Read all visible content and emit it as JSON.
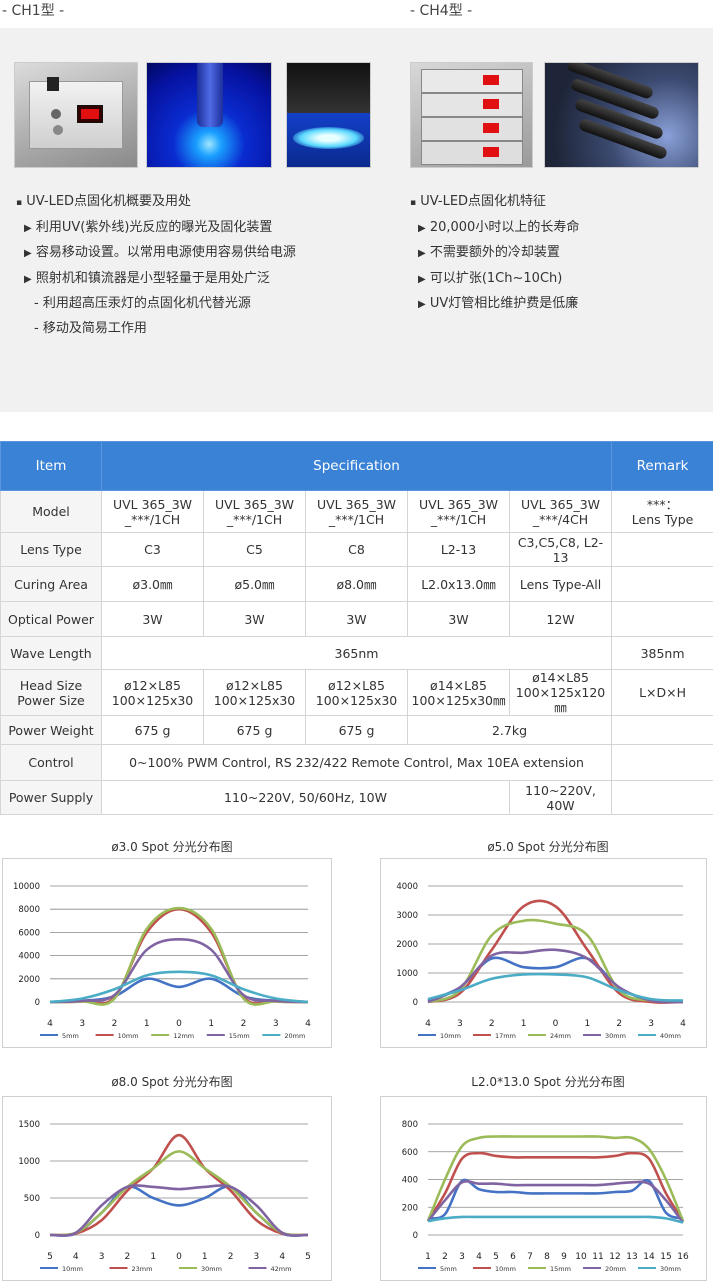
{
  "headers": {
    "ch1": "- CH1型 -",
    "ch4": "- CH4型 -"
  },
  "left_list": {
    "title": "UV-LED点固化机概要及用处",
    "items": [
      "利用UV(紫外线)光反应的曝光及固化装置",
      "容易移动设置。以常用电源使用容易供给电源",
      "照射机和镇流器是小型轻量于是用处广泛"
    ],
    "subitems": [
      "- 利用超高压汞灯的点固化机代替光源",
      "- 移动及简易工作用"
    ]
  },
  "right_list": {
    "title": "UV-LED点固化机特征",
    "items": [
      "20,000小时以上的长寿命",
      "不需要额外的冷却装置",
      "可以扩张(1Ch~10Ch)",
      "UV灯管相比维护费是低廉"
    ]
  },
  "table": {
    "head": {
      "item": "Item",
      "spec": "Specification",
      "remark": "Remark"
    },
    "model": {
      "label": "Model",
      "cells": [
        [
          "UVL 365_3W",
          "_***/1CH"
        ],
        [
          "UVL 365_3W",
          "_***/1CH"
        ],
        [
          "UVL 365_3W",
          "_***/1CH"
        ],
        [
          "UVL 365_3W",
          "_***/1CH"
        ],
        [
          "UVL 365_3W",
          "_***/4CH"
        ]
      ],
      "remark": [
        "***：",
        "Lens Type"
      ]
    },
    "lens": {
      "label": "Lens Type",
      "cells": [
        "C3",
        "C5",
        "C8",
        "L2-13",
        "C3,C5,C8, L2-13"
      ]
    },
    "area": {
      "label": "Curing Area",
      "cells": [
        "ø3.0㎜",
        "ø5.0㎜",
        "ø8.0㎜",
        "L2.0x13.0㎜",
        "Lens Type-All"
      ]
    },
    "power": {
      "label": "Optical Power",
      "cells": [
        "3W",
        "3W",
        "3W",
        "3W",
        "12W"
      ]
    },
    "wave": {
      "label": "Wave Length",
      "value": "365nm",
      "remark": "385nm"
    },
    "head_size": {
      "label": [
        "Head Size",
        "Power Size"
      ],
      "cells": [
        [
          "ø12×L85",
          "100×125x30"
        ],
        [
          "ø12×L85",
          "100×125x30"
        ],
        [
          "ø12×L85",
          "100×125x30"
        ],
        [
          "ø14×L85",
          "100×125x30㎜"
        ],
        [
          "ø14×L85",
          "100×125x120㎜"
        ]
      ],
      "remark": "L×D×H"
    },
    "weight": {
      "label": "Power Weight",
      "cells": [
        "675 g",
        "675 g",
        "675 g"
      ],
      "merged": "2.7kg"
    },
    "control": {
      "label": "Control",
      "value": "0~100% PWM Control, RS 232/422 Remote Control, Max 10EA extension"
    },
    "supply": {
      "label": "Power Supply",
      "value": "110~220V, 50/60Hz, 10W",
      "value_4ch": "110~220V, 40W"
    }
  },
  "colors": {
    "blue": "#4472c4",
    "red": "#c0504d",
    "green": "#9bbb59",
    "purple": "#8064a2",
    "cyan": "#4bacc6",
    "header": "#3a82d6"
  },
  "chart_data": [
    {
      "type": "line",
      "title": "ø3.0 Spot 分光分布图",
      "x": [
        4,
        3,
        2,
        1,
        0,
        1,
        2,
        3,
        4
      ],
      "ylim": [
        0,
        10000
      ],
      "yticks": [
        0,
        2000,
        4000,
        6000,
        8000,
        10000
      ],
      "grid": true,
      "legend": "bottom",
      "series": [
        {
          "name": "5mm",
          "color": "#4472c4",
          "values": [
            0,
            100,
            500,
            2000,
            1300,
            2000,
            500,
            100,
            0
          ]
        },
        {
          "name": "10mm",
          "color": "#c0504d",
          "values": [
            0,
            50,
            400,
            6000,
            8000,
            6000,
            400,
            50,
            0
          ]
        },
        {
          "name": "12mm",
          "color": "#9bbb59",
          "values": [
            0,
            50,
            300,
            6300,
            8100,
            6300,
            300,
            50,
            0
          ]
        },
        {
          "name": "15mm",
          "color": "#8064a2",
          "values": [
            0,
            100,
            600,
            4500,
            5400,
            4500,
            600,
            100,
            0
          ]
        },
        {
          "name": "20mm",
          "color": "#4bacc6",
          "values": [
            0,
            300,
            1100,
            2300,
            2600,
            2300,
            1100,
            300,
            0
          ]
        }
      ]
    },
    {
      "type": "line",
      "title": "ø5.0 Spot 分光分布图",
      "x": [
        4,
        3,
        2,
        1,
        0,
        1,
        2,
        3,
        4
      ],
      "ylim": [
        0,
        4000
      ],
      "yticks": [
        0,
        1000,
        2000,
        3000,
        4000
      ],
      "grid": true,
      "legend": "bottom",
      "series": [
        {
          "name": "10mm",
          "color": "#4472c4",
          "values": [
            50,
            500,
            1500,
            1200,
            1200,
            1500,
            500,
            50,
            0
          ]
        },
        {
          "name": "17mm",
          "color": "#c0504d",
          "values": [
            0,
            300,
            1800,
            3300,
            3300,
            1800,
            300,
            0,
            0
          ]
        },
        {
          "name": "24mm",
          "color": "#9bbb59",
          "values": [
            0,
            400,
            2300,
            2800,
            2700,
            2300,
            400,
            50,
            0
          ]
        },
        {
          "name": "30mm",
          "color": "#8064a2",
          "values": [
            0,
            500,
            1600,
            1700,
            1800,
            1500,
            500,
            50,
            0
          ]
        },
        {
          "name": "40mm",
          "color": "#4bacc6",
          "values": [
            100,
            400,
            800,
            950,
            950,
            850,
            400,
            100,
            50
          ]
        }
      ]
    },
    {
      "type": "line",
      "title": "ø8.0 Spot 分光分布图",
      "x": [
        5,
        4,
        3,
        2,
        1,
        0,
        1,
        2,
        3,
        4,
        5
      ],
      "ylim": [
        0,
        1500
      ],
      "yticks": [
        0,
        500,
        1000,
        1500
      ],
      "grid": true,
      "legend": "bottom",
      "series": [
        {
          "name": "10mm",
          "color": "#4472c4",
          "values": [
            0,
            20,
            300,
            650,
            500,
            400,
            500,
            650,
            300,
            20,
            0
          ]
        },
        {
          "name": "23mm",
          "color": "#c0504d",
          "values": [
            0,
            20,
            200,
            600,
            900,
            1350,
            900,
            600,
            200,
            20,
            0
          ]
        },
        {
          "name": "30mm",
          "color": "#9bbb59",
          "values": [
            0,
            30,
            300,
            650,
            900,
            1130,
            900,
            650,
            300,
            30,
            0
          ]
        },
        {
          "name": "42mm",
          "color": "#8064a2",
          "values": [
            0,
            30,
            400,
            650,
            650,
            620,
            650,
            650,
            400,
            30,
            0
          ]
        }
      ]
    },
    {
      "type": "line",
      "title": "L2.0*13.0 Spot 分光分布图",
      "x": [
        1,
        2,
        3,
        4,
        5,
        6,
        7,
        8,
        9,
        10,
        11,
        12,
        13,
        14,
        15,
        16
      ],
      "ylim": [
        0,
        800
      ],
      "yticks": [
        0,
        200,
        400,
        600,
        800
      ],
      "grid": true,
      "legend": "bottom",
      "series": [
        {
          "name": "5mm",
          "color": "#4472c4",
          "values": [
            120,
            150,
            390,
            330,
            310,
            310,
            300,
            300,
            300,
            300,
            300,
            310,
            320,
            390,
            160,
            120
          ]
        },
        {
          "name": "10mm",
          "color": "#c0504d",
          "values": [
            100,
            300,
            550,
            590,
            570,
            560,
            560,
            560,
            560,
            560,
            560,
            570,
            590,
            550,
            300,
            100
          ]
        },
        {
          "name": "15mm",
          "color": "#9bbb59",
          "values": [
            100,
            400,
            640,
            700,
            710,
            710,
            710,
            710,
            710,
            710,
            710,
            700,
            700,
            620,
            400,
            100
          ]
        },
        {
          "name": "20mm",
          "color": "#8064a2",
          "values": [
            100,
            250,
            380,
            370,
            370,
            360,
            360,
            360,
            360,
            360,
            360,
            370,
            380,
            370,
            250,
            90
          ]
        },
        {
          "name": "30mm",
          "color": "#4bacc6",
          "values": [
            100,
            120,
            130,
            130,
            130,
            130,
            130,
            130,
            130,
            130,
            130,
            130,
            130,
            130,
            120,
            90
          ]
        }
      ]
    }
  ]
}
